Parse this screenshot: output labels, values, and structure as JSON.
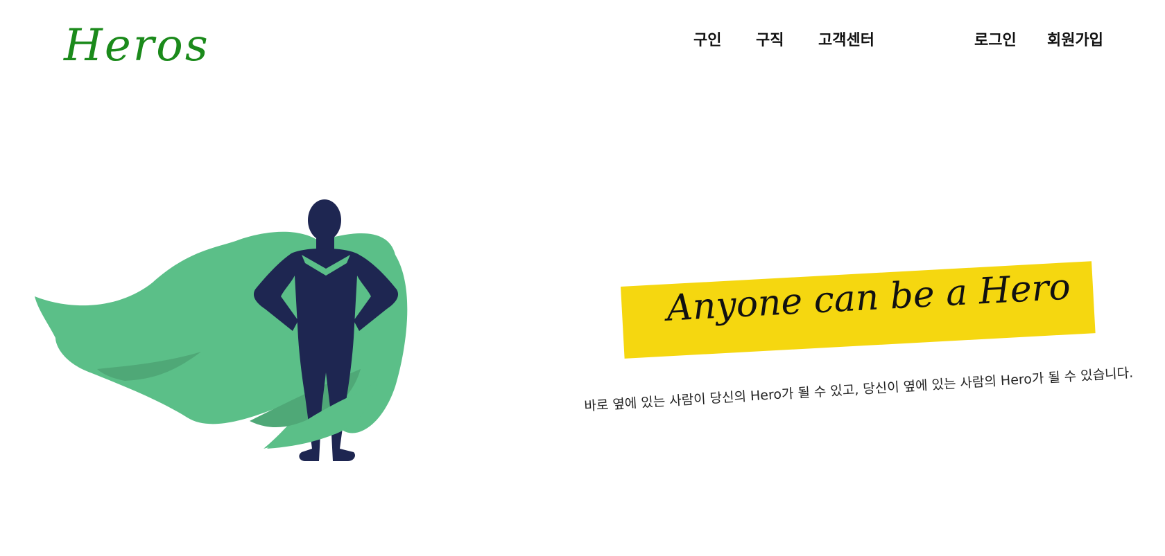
{
  "header": {
    "logo": "Heros",
    "nav": {
      "hire": "구인",
      "job_search": "구직",
      "customer_center": "고객센터",
      "login": "로그인",
      "signup": "회원가입"
    }
  },
  "hero": {
    "banner_text": "Anyone can be a Hero",
    "subtitle": "바로 옆에 있는 사람이 당신의 Hero가 될 수 있고, 당신이 옆에 있는 사람의 Hero가 될 수 있습니다.",
    "illustration": "superhero-with-cape-icon",
    "colors": {
      "cape": "#5bbf88",
      "cape_shadow": "#4fa877",
      "figure": "#1e2651",
      "banner": "#f5d710",
      "logo": "#1b8a1b"
    }
  }
}
